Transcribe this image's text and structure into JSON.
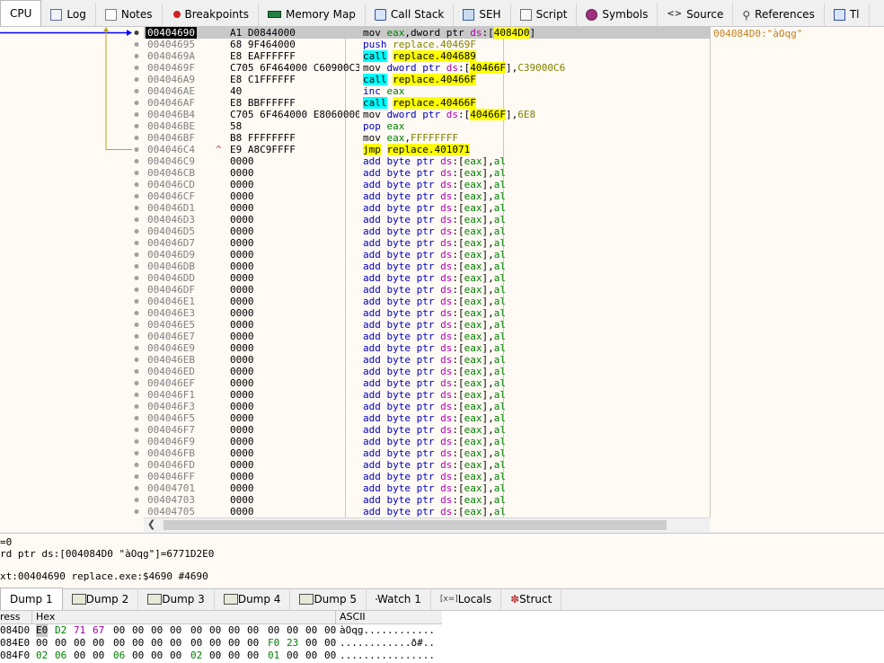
{
  "tabs": [
    {
      "label": "CPU",
      "icon": "cpu-icon",
      "active": true
    },
    {
      "label": "Log",
      "icon": "log-icon"
    },
    {
      "label": "Notes",
      "icon": "notes-icon"
    },
    {
      "label": "Breakpoints",
      "icon": "breakpoint-dot-icon"
    },
    {
      "label": "Memory Map",
      "icon": "memory-map-icon"
    },
    {
      "label": "Call Stack",
      "icon": "call-stack-icon"
    },
    {
      "label": "SEH",
      "icon": "seh-icon"
    },
    {
      "label": "Script",
      "icon": "script-icon"
    },
    {
      "label": "Symbols",
      "icon": "symbols-icon"
    },
    {
      "label": "Source",
      "icon": "source-code-icon"
    },
    {
      "label": "References",
      "icon": "references-search-icon"
    },
    {
      "label": "Tl",
      "icon": "threads-icon"
    }
  ],
  "disasm": {
    "current_address": "00404690",
    "comment": "004084D0:\"àOqg\"",
    "rows": [
      {
        "addr": "00404690",
        "hex": "A1 D0844000",
        "arrow": "",
        "asm": [
          [
            "mov ",
            "kw-mov"
          ],
          [
            "eax",
            "reg"
          ],
          [
            ",dword ptr ",
            ""
          ],
          [
            "ds",
            "ds"
          ],
          [
            ":[",
            ""
          ],
          [
            "4084D0",
            "hl"
          ],
          [
            "]",
            ""
          ]
        ]
      },
      {
        "addr": "00404695",
        "hex": "68 9F464000",
        "arrow": "",
        "asm": [
          [
            "push ",
            "mem"
          ],
          [
            "replace.40469F",
            "num"
          ]
        ]
      },
      {
        "addr": "0040469A",
        "hex": "E8 EAFFFFFF",
        "arrow": "",
        "asm": [
          [
            "call",
            "callhl"
          ],
          [
            " ",
            ""
          ],
          [
            "replace.404689",
            "hl"
          ]
        ]
      },
      {
        "addr": "0040469F",
        "hex": "C705 6F464000 C60900C3",
        "arrow": "",
        "asm": [
          [
            "mov ",
            "kw-mov"
          ],
          [
            "dword ptr ",
            "mem"
          ],
          [
            "ds",
            "ds"
          ],
          [
            ":[",
            ""
          ],
          [
            "40466F",
            "hl"
          ],
          [
            "],",
            ""
          ],
          [
            "C39000C6",
            "num"
          ]
        ]
      },
      {
        "addr": "004046A9",
        "hex": "E8 C1FFFFFF",
        "arrow": "",
        "asm": [
          [
            "call",
            "callhl"
          ],
          [
            " ",
            ""
          ],
          [
            "replace.40466F",
            "hl"
          ]
        ]
      },
      {
        "addr": "004046AE",
        "hex": "40",
        "arrow": "",
        "asm": [
          [
            "inc ",
            "mem"
          ],
          [
            "eax",
            "reg"
          ]
        ]
      },
      {
        "addr": "004046AF",
        "hex": "E8 BBFFFFFF",
        "arrow": "",
        "asm": [
          [
            "call",
            "callhl"
          ],
          [
            " ",
            ""
          ],
          [
            "replace.40466F",
            "hl"
          ]
        ]
      },
      {
        "addr": "004046B4",
        "hex": "C705 6F464000 E8060000",
        "arrow": "",
        "asm": [
          [
            "mov ",
            "kw-mov"
          ],
          [
            "dword ptr ",
            "mem"
          ],
          [
            "ds",
            "ds"
          ],
          [
            ":[",
            ""
          ],
          [
            "40466F",
            "hl"
          ],
          [
            "],",
            ""
          ],
          [
            "6E8",
            "num"
          ]
        ]
      },
      {
        "addr": "004046BE",
        "hex": "58",
        "arrow": "",
        "asm": [
          [
            "pop ",
            "mem"
          ],
          [
            "eax",
            "reg"
          ]
        ]
      },
      {
        "addr": "004046BF",
        "hex": "B8 FFFFFFFF",
        "arrow": "",
        "asm": [
          [
            "mov ",
            "kw-mov"
          ],
          [
            "eax",
            "reg"
          ],
          [
            ",",
            ""
          ],
          [
            "FFFFFFFF",
            "num"
          ]
        ]
      },
      {
        "addr": "004046C4",
        "hex": "E9 A8C9FFFF",
        "arrow": "^",
        "asm": [
          [
            "jmp",
            "hl"
          ],
          [
            " ",
            ""
          ],
          [
            "replace.401071",
            "hl"
          ]
        ]
      },
      {
        "addr": "004046C9",
        "hex": "0000"
      },
      {
        "addr": "004046CB",
        "hex": "0000"
      },
      {
        "addr": "004046CD",
        "hex": "0000"
      },
      {
        "addr": "004046CF",
        "hex": "0000"
      },
      {
        "addr": "004046D1",
        "hex": "0000"
      },
      {
        "addr": "004046D3",
        "hex": "0000"
      },
      {
        "addr": "004046D5",
        "hex": "0000"
      },
      {
        "addr": "004046D7",
        "hex": "0000"
      },
      {
        "addr": "004046D9",
        "hex": "0000"
      },
      {
        "addr": "004046DB",
        "hex": "0000"
      },
      {
        "addr": "004046DD",
        "hex": "0000"
      },
      {
        "addr": "004046DF",
        "hex": "0000"
      },
      {
        "addr": "004046E1",
        "hex": "0000"
      },
      {
        "addr": "004046E3",
        "hex": "0000"
      },
      {
        "addr": "004046E5",
        "hex": "0000"
      },
      {
        "addr": "004046E7",
        "hex": "0000"
      },
      {
        "addr": "004046E9",
        "hex": "0000"
      },
      {
        "addr": "004046EB",
        "hex": "0000"
      },
      {
        "addr": "004046ED",
        "hex": "0000"
      },
      {
        "addr": "004046EF",
        "hex": "0000"
      },
      {
        "addr": "004046F1",
        "hex": "0000"
      },
      {
        "addr": "004046F3",
        "hex": "0000"
      },
      {
        "addr": "004046F5",
        "hex": "0000"
      },
      {
        "addr": "004046F7",
        "hex": "0000"
      },
      {
        "addr": "004046F9",
        "hex": "0000"
      },
      {
        "addr": "004046FB",
        "hex": "0000"
      },
      {
        "addr": "004046FD",
        "hex": "0000"
      },
      {
        "addr": "004046FF",
        "hex": "0000"
      },
      {
        "addr": "00404701",
        "hex": "0000"
      },
      {
        "addr": "00404703",
        "hex": "0000"
      },
      {
        "addr": "00404705",
        "hex": "0000"
      }
    ],
    "filler_asm": [
      [
        "add byte ptr ",
        "mem"
      ],
      [
        "ds",
        "ds"
      ],
      [
        ":[",
        ""
      ],
      [
        "eax",
        "reg"
      ],
      [
        "],",
        ""
      ],
      [
        "al",
        "reg"
      ]
    ]
  },
  "info": {
    "line1": "=0",
    "line2": "rd ptr ds:[004084D0 \"àOqg\"]=6771D2E0",
    "line3": "xt:00404690 replace.exe:$4690 #4690"
  },
  "bottom_tabs": [
    {
      "label": "Dump 1",
      "icon": "dump-icon",
      "active": true
    },
    {
      "label": "Dump 2",
      "icon": "dump-icon"
    },
    {
      "label": "Dump 3",
      "icon": "dump-icon"
    },
    {
      "label": "Dump 4",
      "icon": "dump-icon"
    },
    {
      "label": "Dump 5",
      "icon": "dump-icon"
    },
    {
      "label": "Watch 1",
      "icon": "watch-icon"
    },
    {
      "label": "Locals",
      "icon": "locals-icon"
    },
    {
      "label": "Struct",
      "icon": "struct-icon"
    }
  ],
  "dump": {
    "headers": {
      "address": "ress",
      "hex": "Hex",
      "ascii": "ASCII"
    },
    "rows": [
      {
        "addr": "084D0",
        "bytes": [
          "E0",
          "D2",
          "71",
          "67",
          "00",
          "00",
          "00",
          "00",
          "00",
          "00",
          "00",
          "00",
          "00",
          "00",
          "00",
          "00"
        ],
        "ascii": "àOqg............"
      },
      {
        "addr": "084E0",
        "bytes": [
          "00",
          "00",
          "00",
          "00",
          "00",
          "00",
          "00",
          "00",
          "00",
          "00",
          "00",
          "00",
          "F0",
          "23",
          "00",
          "00"
        ],
        "ascii": "............ð#.."
      },
      {
        "addr": "084F0",
        "bytes": [
          "02",
          "06",
          "00",
          "00",
          "06",
          "00",
          "00",
          "00",
          "02",
          "00",
          "00",
          "00",
          "01",
          "00",
          "00",
          "00"
        ],
        "ascii": "................"
      }
    ]
  },
  "colors": {
    "accent": "#0000ff",
    "highlight": "#ffff00",
    "call": "#00ffff",
    "background": "#fffaf4"
  }
}
